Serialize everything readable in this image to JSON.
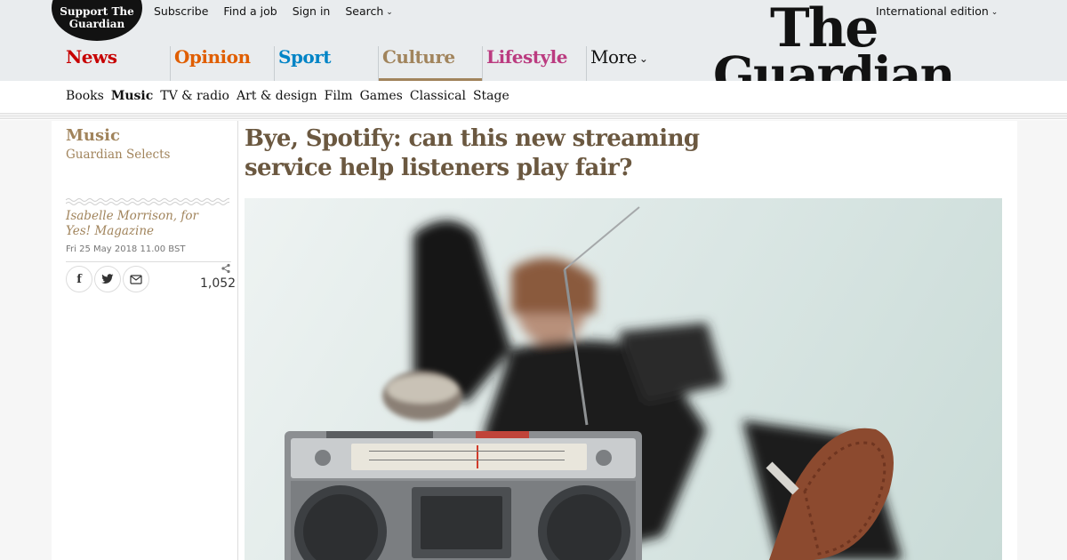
{
  "header": {
    "support_label": "Support The Guardian",
    "top_links": [
      "Subscribe",
      "Find a job",
      "Sign in",
      "Search"
    ],
    "edition": "International edition",
    "logo_line1": "The",
    "logo_line2": "Guardian",
    "pillars": [
      {
        "label": "News",
        "color": "#c70000"
      },
      {
        "label": "Opinion",
        "color": "#e05e00"
      },
      {
        "label": "Sport",
        "color": "#0084c6"
      },
      {
        "label": "Culture",
        "color": "#a1845c"
      },
      {
        "label": "Lifestyle",
        "color": "#bb3b80"
      },
      {
        "label": "More",
        "color": "#121212"
      }
    ]
  },
  "subnav": {
    "items": [
      "Books",
      "Music",
      "TV & radio",
      "Art & design",
      "Film",
      "Games",
      "Classical",
      "Stage"
    ]
  },
  "article": {
    "section": "Music",
    "series": "Guardian Selects",
    "byline": "Isabelle Morrison, for Yes! Magazine",
    "date": "Fri 25 May 2018 11.00 BST",
    "share_count": "1,052",
    "headline": "Bye, Spotify: can this new streaming service help listeners play fair?"
  },
  "icons": {
    "facebook": "facebook-icon",
    "twitter": "twitter-icon",
    "email": "email-icon",
    "share": "share-icon"
  },
  "colors": {
    "accent": "#a1845c",
    "headline": "#6b5840"
  }
}
